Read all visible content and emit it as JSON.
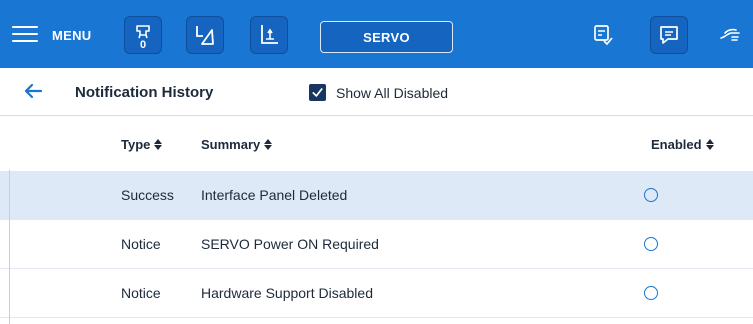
{
  "topbar": {
    "menu_label": "MENU",
    "counter_value": "0",
    "servo_label": "SERVO",
    "background_color": "#1976d2",
    "icons": [
      "menu-icon",
      "robot-gripper-icon",
      "angle-icon",
      "coordinate-frame-icon",
      "program-download-icon",
      "message-icon",
      "hand-guide-icon"
    ]
  },
  "header": {
    "title": "Notification History",
    "show_all_disabled_label": "Show All Disabled",
    "show_all_disabled_checked": true
  },
  "table": {
    "columns": [
      "Type",
      "Summary",
      "Enabled"
    ],
    "rows": [
      {
        "type": "Success",
        "summary": "Interface Panel Deleted",
        "enabled": false,
        "selected": true
      },
      {
        "type": "Notice",
        "summary": "SERVO Power ON Required",
        "enabled": false,
        "selected": false
      },
      {
        "type": "Notice",
        "summary": "Hardware Support Disabled",
        "enabled": false,
        "selected": false
      }
    ]
  }
}
